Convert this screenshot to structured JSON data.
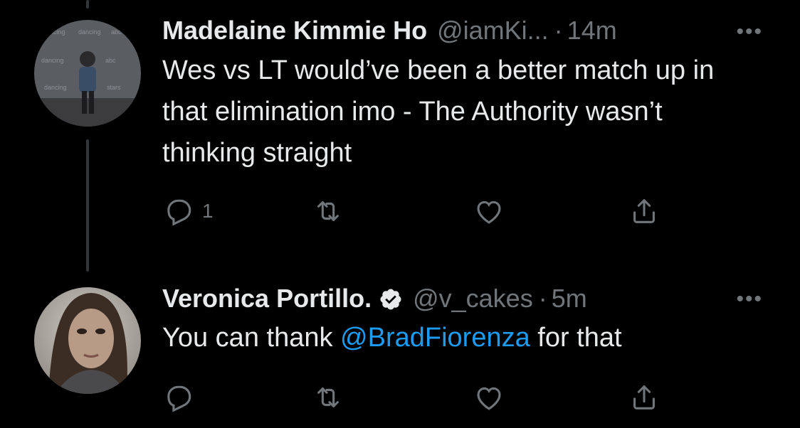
{
  "tweets": [
    {
      "name": "Madelaine Kimmie Ho",
      "handle": "@iamKi...",
      "dot": "·",
      "time": "14m",
      "text": "Wes vs LT would’ve been a better match up in that elimination imo - The Authority wasn’t thinking straight",
      "reply_count": "1",
      "verified": false
    },
    {
      "name": "Veronica Portillo.",
      "handle": "@v_cakes",
      "dot": "·",
      "time": "5m",
      "text_before": "You can thank ",
      "mention": "@BradFiorenza",
      "text_after": " for that",
      "reply_count": "",
      "verified": true
    }
  ],
  "more_label": "•••",
  "icons": [
    "reply-icon",
    "retweet-icon",
    "like-icon",
    "share-icon",
    "verified-badge-icon",
    "more-icon"
  ],
  "colors": {
    "background": "#000000",
    "text": "#e7e9ea",
    "muted": "#71767b",
    "link": "#1d9bf0",
    "verified": "#e7e9ea"
  }
}
